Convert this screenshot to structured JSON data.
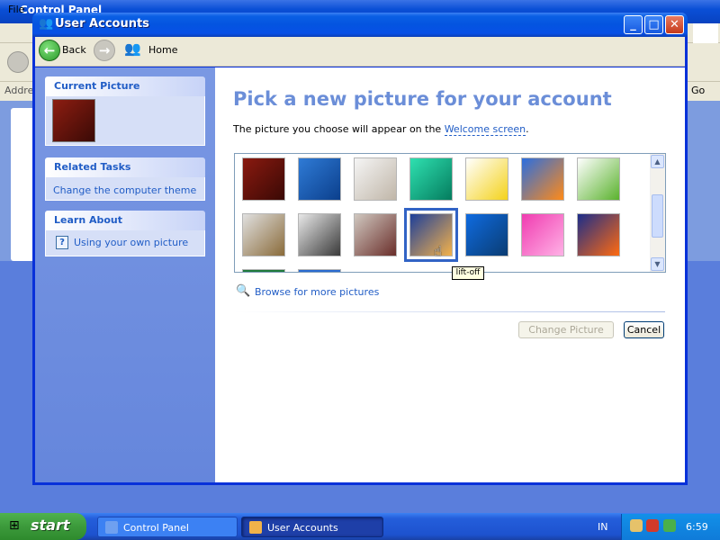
{
  "background_window": {
    "title": "Control Panel",
    "menu_file": "File",
    "address_label": "Addres",
    "go_label": "Go"
  },
  "window": {
    "title": "User Accounts",
    "icon": "users-icon"
  },
  "nav": {
    "back_label": "Back",
    "forward_icon": "forward-arrow-icon",
    "home_label": "Home"
  },
  "sidebar": {
    "current_picture_title": "Current Picture",
    "related_tasks_title": "Related Tasks",
    "related_tasks_items": [
      "Change the computer theme"
    ],
    "learn_about_title": "Learn About",
    "learn_about_items": [
      "Using your own picture"
    ]
  },
  "main": {
    "heading": "Pick a new picture for your account",
    "intro_text": "The picture you choose will appear on the ",
    "intro_link": "Welcome screen",
    "intro_end": ".",
    "pictures": [
      {
        "name": "chess",
        "colors": [
          "#8a1a10",
          "#3a0905"
        ]
      },
      {
        "name": "dirt-bike",
        "colors": [
          "#2f7bd6",
          "#0b3f8c"
        ]
      },
      {
        "name": "dog",
        "colors": [
          "#f5f5f5",
          "#c0b6a8"
        ]
      },
      {
        "name": "drip",
        "colors": [
          "#2fe0b0",
          "#047c5e"
        ]
      },
      {
        "name": "duck",
        "colors": [
          "#ffffff",
          "#f4d21a"
        ]
      },
      {
        "name": "fish",
        "colors": [
          "#2a6ee0",
          "#ff8a18"
        ]
      },
      {
        "name": "frog",
        "colors": [
          "#ffffff",
          "#5ab22d"
        ]
      },
      {
        "name": "guitar",
        "colors": [
          "#e0e0e0",
          "#8a6b3a"
        ]
      },
      {
        "name": "horses",
        "colors": [
          "#e8e8e8",
          "#3a3a3a"
        ]
      },
      {
        "name": "karate",
        "colors": [
          "#d0c8c0",
          "#6a2e2a"
        ]
      },
      {
        "name": "lift-off",
        "colors": [
          "#1d3f9a",
          "#f4b24a"
        ]
      },
      {
        "name": "palm-trees",
        "colors": [
          "#0f6be0",
          "#0a3c72"
        ]
      },
      {
        "name": "flower",
        "colors": [
          "#f03cb0",
          "#ffb2e6"
        ]
      },
      {
        "name": "orange-flower",
        "colors": [
          "#1b2d8a",
          "#ff6a10"
        ]
      }
    ],
    "tooltip": "lift-off",
    "browse_label": "Browse for more pictures",
    "change_button": "Change Picture",
    "cancel_button": "Cancel"
  },
  "taskbar": {
    "start_label": "start",
    "tasks": [
      "Control Panel",
      "User Accounts"
    ],
    "language": "IN",
    "clock": "6:59"
  }
}
